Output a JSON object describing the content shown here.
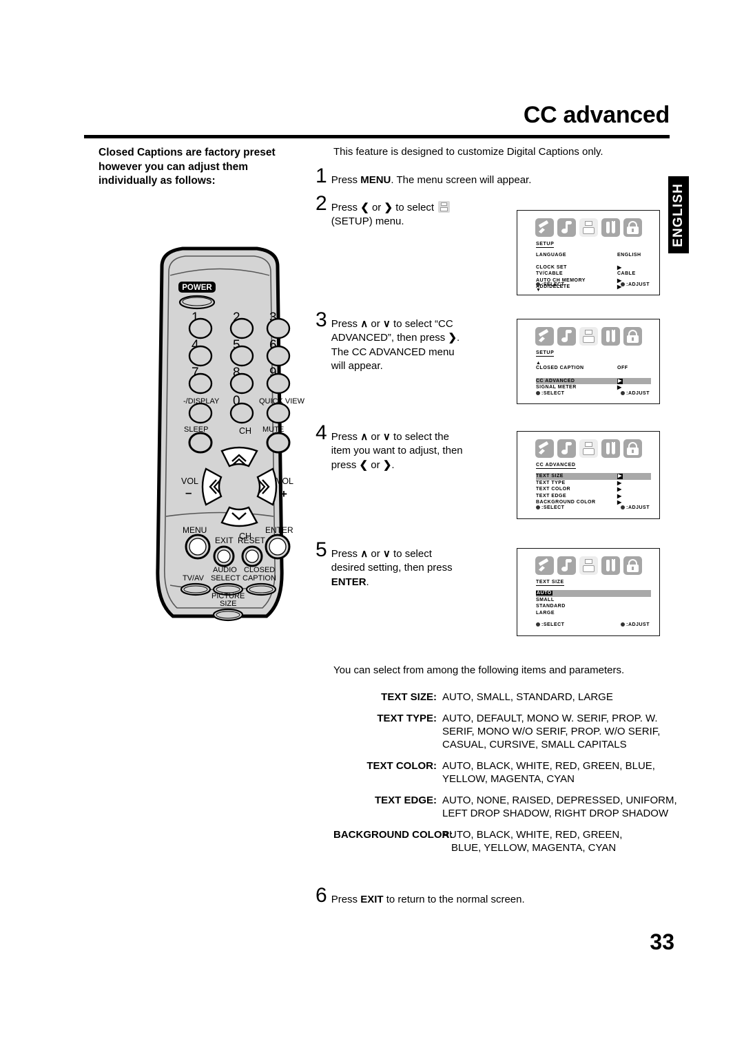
{
  "page": {
    "title": "CC advanced",
    "number": "33",
    "side_tab": "ENGLISH"
  },
  "intro": {
    "text": "Closed Captions are factory preset however you can adjust them individually as follows:"
  },
  "lead": "This feature is designed to customize Digital Captions only.",
  "steps": [
    {
      "num": "1",
      "parts": [
        {
          "t": "Press ",
          "b": false
        },
        {
          "t": "MENU",
          "b": true
        },
        {
          "t": ". The menu screen will appear.",
          "b": false
        }
      ]
    },
    {
      "num": "2",
      "line1_a": "Press ",
      "left_arrow": "❮",
      "or": " or ",
      "right_arrow": "❯",
      "line1_b": " to select ",
      "icon": "setup-floppy-icon",
      "line2": "(SETUP) menu."
    },
    {
      "num": "3",
      "line1_a": "Press ",
      "up_arrow": "∧",
      "or": " or ",
      "down_arrow": "∨",
      "line1_b": " to select “CC",
      "line2_a": "ADVANCED”, then press ",
      "right_arrow": "❯",
      "line2_b": ".",
      "line3": "The CC ADVANCED menu",
      "line4": "will appear."
    },
    {
      "num": "4",
      "line1_a": "Press ",
      "up_arrow": "∧",
      "or": " or ",
      "down_arrow": "∨",
      "line1_b": " to select the",
      "line2": "item you want to adjust, then",
      "line3_a": "press ",
      "left_arrow": "❮",
      "right_arrow": "❯",
      "line3_b": "."
    },
    {
      "num": "5",
      "line1_a": "Press ",
      "up_arrow": "∧",
      "or": " or ",
      "down_arrow": "∨",
      "line1_b": " to select",
      "line2": "desired setting, then press",
      "line3_bold": "ENTER",
      "line3_end": "."
    },
    {
      "num": "6",
      "parts": [
        {
          "t": "Press ",
          "b": false
        },
        {
          "t": "EXIT",
          "b": true
        },
        {
          "t": " to return to the normal screen.",
          "b": false
        }
      ]
    }
  ],
  "osd": {
    "icon_names": [
      "picture-brush-icon",
      "audio-note-icon",
      "setup-floppy-icon",
      "tools-icon",
      "lock-icon"
    ],
    "footer": {
      "select": ":SELECT",
      "adjust": ":ADJUST"
    },
    "screens": [
      {
        "name": "setup-menu",
        "header": "SETUP",
        "selected_icon_index": 2,
        "rows": [
          {
            "label": "LANGUAGE",
            "value": "ENGLISH",
            "highlight": false,
            "gap": true
          },
          {
            "label": "CLOCK SET",
            "value": "▶",
            "highlight": false
          },
          {
            "label": "TV/CABLE",
            "value": "CABLE",
            "highlight": false
          },
          {
            "label": "AUTO CH MEMORY",
            "value": "▶",
            "highlight": false
          },
          {
            "label": "ADD/DELETE",
            "value": "▶",
            "highlight": false
          }
        ],
        "scroll_down": "▼"
      },
      {
        "name": "setup-cc-menu",
        "header": "SETUP",
        "selected_icon_index": 2,
        "scroll_up": "▲",
        "rows": [
          {
            "label": "CLOSED CAPTION",
            "value": "OFF",
            "highlight": false,
            "gap": true
          },
          {
            "label": "CC ADVANCED",
            "value": "▶",
            "highlight": true,
            "boxed": true
          },
          {
            "label": "SIGNAL METER",
            "value": "▶",
            "highlight": false
          }
        ]
      },
      {
        "name": "cc-advanced-menu",
        "header": "CC ADVANCED",
        "selected_icon_index": 2,
        "rows": [
          {
            "label": "TEXT SIZE",
            "value": "▶",
            "highlight": true,
            "boxed": true
          },
          {
            "label": "TEXT TYPE",
            "value": "▶",
            "highlight": false
          },
          {
            "label": "TEXT COLOR",
            "value": "▶",
            "highlight": false
          },
          {
            "label": "TEXT EDGE",
            "value": "▶",
            "highlight": false
          },
          {
            "label": "BACKGROUND COLOR",
            "value": "▶",
            "highlight": false
          }
        ]
      },
      {
        "name": "text-size-menu",
        "header": "TEXT SIZE",
        "selected_icon_index": 2,
        "rows": [
          {
            "label": "AUTO",
            "value": "",
            "highlight": true,
            "inverted": true
          },
          {
            "label": "SMALL",
            "value": "",
            "highlight": false
          },
          {
            "label": "STANDARD",
            "value": "",
            "highlight": false
          },
          {
            "label": "LARGE",
            "value": "",
            "highlight": false
          }
        ]
      }
    ]
  },
  "params": {
    "lead": "You can select from among the following items and parameters.",
    "rows": [
      {
        "key": "TEXT SIZE:",
        "values": [
          "AUTO, SMALL, STANDARD, LARGE"
        ]
      },
      {
        "key": "TEXT TYPE:",
        "values": [
          "AUTO, DEFAULT, MONO W. SERIF, PROP. W.",
          "SERIF, MONO W/O SERIF, PROP. W/O SERIF,",
          "CASUAL, CURSIVE, SMALL CAPITALS"
        ]
      },
      {
        "key": "TEXT COLOR:",
        "values": [
          "AUTO, BLACK, WHITE, RED, GREEN, BLUE,",
          "YELLOW, MAGENTA, CYAN"
        ]
      },
      {
        "key": "TEXT EDGE:",
        "values": [
          "AUTO, NONE, RAISED, DEPRESSED, UNIFORM,",
          "LEFT DROP SHADOW, RIGHT DROP SHADOW"
        ]
      },
      {
        "key": "BACKGROUND COLOR:",
        "values": [
          "AUTO, BLACK, WHITE, RED, GREEN,",
          "BLUE, YELLOW, MAGENTA, CYAN"
        ]
      }
    ]
  },
  "remote": {
    "power": "POWER",
    "numbers": [
      "1",
      "2",
      "3",
      "4",
      "5",
      "6",
      "7",
      "8",
      "9"
    ],
    "display": "-/DISPLAY",
    "zero": "0",
    "quick_view": "QUICK VIEW",
    "sleep": "SLEEP",
    "mute": "MUTE",
    "ch_up": "CH",
    "ch_down": "CH",
    "vol_minus_label": "VOL",
    "vol_minus_sign": "–",
    "vol_plus_label": "VOL",
    "vol_plus_sign": "+",
    "menu": "MENU",
    "enter": "ENTER",
    "exit": "EXIT",
    "reset": "RESET",
    "tv_av": "TV/AV",
    "audio_select": "AUDIO\nSELECT",
    "audio_select_l1": "AUDIO",
    "audio_select_l2": "SELECT",
    "closed_caption_l1": "CLOSED",
    "closed_caption_l2": "CAPTION",
    "picture_size_l1": "PICTURE",
    "picture_size_l2": "SIZE"
  },
  "colors": {
    "osd_icon_gray": "#a6a6a6",
    "osd_highlight": "#a9a9a9",
    "remote_body": "#d4d4d4"
  }
}
